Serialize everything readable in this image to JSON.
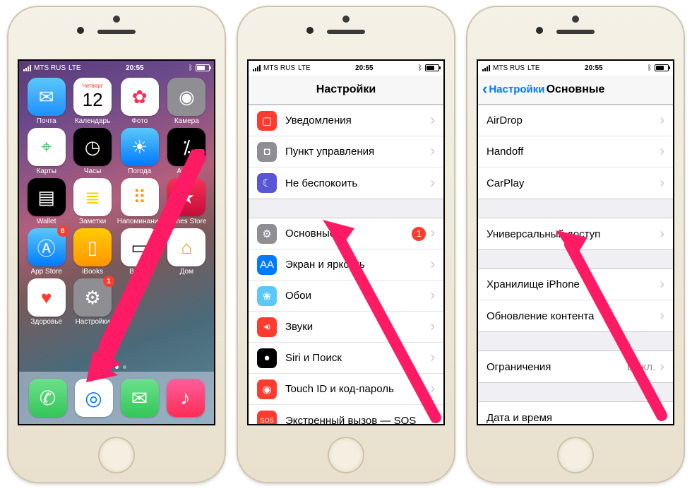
{
  "status": {
    "carrier": "MTS RUS",
    "net": "LTE",
    "time": "20:55"
  },
  "home": {
    "apps": [
      {
        "label": "Почта",
        "bg": "linear-gradient(#5ac8fa,#1e90ff)",
        "glyph": "✉︎"
      },
      {
        "label": "Календарь",
        "bg": "#fff",
        "glyph": "12",
        "sub": "Четверг",
        "text": "#000"
      },
      {
        "label": "Фото",
        "bg": "#fff",
        "glyph": "✿",
        "text": "#ff2d55"
      },
      {
        "label": "Камера",
        "bg": "#8e8e93",
        "glyph": "◉"
      },
      {
        "label": "Карты",
        "bg": "#fff",
        "glyph": "⌖",
        "text": "#34c759"
      },
      {
        "label": "Часы",
        "bg": "#000",
        "glyph": "◷"
      },
      {
        "label": "Погода",
        "bg": "linear-gradient(#5ac8fa,#007aff)",
        "glyph": "☀︎"
      },
      {
        "label": "Акции",
        "bg": "#000",
        "glyph": "⁒"
      },
      {
        "label": "Wallet",
        "bg": "#000",
        "glyph": "▤"
      },
      {
        "label": "Заметки",
        "bg": "#fff",
        "glyph": "≣",
        "text": "#ffcc00"
      },
      {
        "label": "Напоминания",
        "bg": "#fff",
        "glyph": "⠿",
        "text": "#ff9500"
      },
      {
        "label": "iTunes Store",
        "bg": "linear-gradient(#ff2d55,#c30d3b)",
        "glyph": "★"
      },
      {
        "label": "App Store",
        "bg": "linear-gradient(#5ac8fa,#007aff)",
        "glyph": "Ⓐ",
        "badge": "6"
      },
      {
        "label": "iBooks",
        "bg": "linear-gradient(#ffcc00,#ff9500)",
        "glyph": "▯"
      },
      {
        "label": "Видео",
        "bg": "#fff",
        "glyph": "▭",
        "text": "#000"
      },
      {
        "label": "Дом",
        "bg": "#fff",
        "glyph": "⌂",
        "text": "#ff9500"
      },
      {
        "label": "Здоровье",
        "bg": "#fff",
        "glyph": "♥︎",
        "text": "#ff3b30"
      },
      {
        "label": "Настройки",
        "bg": "#8e8e93",
        "glyph": "⚙︎",
        "badge": "1"
      }
    ],
    "dock": [
      {
        "bg": "linear-gradient(#6be08a,#34c759)",
        "glyph": "✆"
      },
      {
        "bg": "#fff",
        "glyph": "◎",
        "text": "#007aff"
      },
      {
        "bg": "linear-gradient(#6be08a,#34c759)",
        "glyph": "✉︎"
      },
      {
        "bg": "linear-gradient(#ff5e9c,#ff2d55)",
        "glyph": "♪"
      }
    ]
  },
  "settings": {
    "title": "Настройки",
    "groups": [
      [
        {
          "label": "Уведомления",
          "icon": "▢",
          "bg": "#ff3b30"
        },
        {
          "label": "Пункт управления",
          "icon": "◘",
          "bg": "#8e8e93"
        },
        {
          "label": "Не беспокоить",
          "icon": "☾",
          "bg": "#5856d6"
        }
      ],
      [
        {
          "label": "Основные",
          "icon": "⚙︎",
          "bg": "#8e8e93",
          "badge": "1"
        },
        {
          "label": "Экран и яркость",
          "icon": "AA",
          "bg": "#007aff"
        },
        {
          "label": "Обои",
          "icon": "❀",
          "bg": "#5ac8fa"
        },
        {
          "label": "Звуки",
          "icon": "◀︎)",
          "bg": "#ff3b30"
        },
        {
          "label": "Siri и Поиск",
          "icon": "●",
          "bg": "#000"
        },
        {
          "label": "Touch ID и код-пароль",
          "icon": "◉",
          "bg": "#ff3b30"
        },
        {
          "label": "Экстренный вызов — SOS",
          "icon": "SOS",
          "bg": "#ff3b30"
        }
      ]
    ]
  },
  "general": {
    "back": "Настройки",
    "title": "Основные",
    "groups": [
      [
        {
          "label": "AirDrop"
        },
        {
          "label": "Handoff"
        },
        {
          "label": "CarPlay"
        }
      ],
      [
        {
          "label": "Универсальный доступ"
        }
      ],
      [
        {
          "label": "Хранилище iPhone"
        },
        {
          "label": "Обновление контента"
        }
      ],
      [
        {
          "label": "Ограничения",
          "value": "Выкл."
        }
      ],
      [
        {
          "label": "Дата и время"
        }
      ]
    ]
  }
}
